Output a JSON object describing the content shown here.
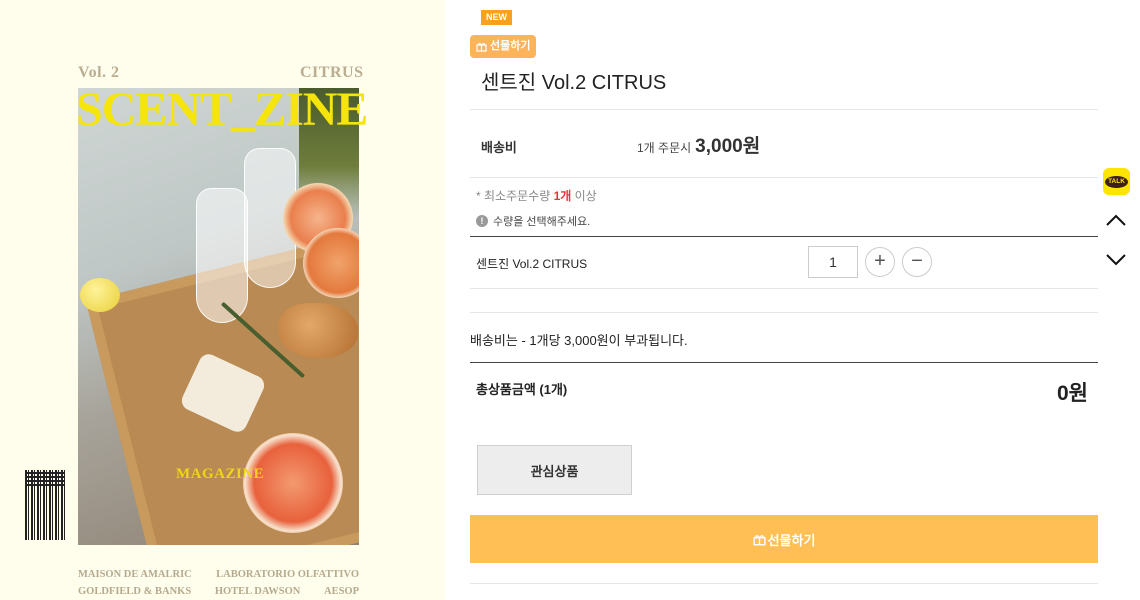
{
  "cover": {
    "vol": "Vol. 2",
    "edition": "CITRUS",
    "title": "SCENT_ZINE",
    "subtitle": "MAGAZINE",
    "credits_row1": [
      "MAISON DE AMALRIC",
      "LABORATORIO OLFATTIVO"
    ],
    "credits_row2": [
      "GOLDFIELD & BANKS",
      "HOTEL DAWSON",
      "AESOP"
    ]
  },
  "badges": {
    "new": "NEW",
    "gift": "선물하기"
  },
  "product": {
    "title": "센트진 Vol.2 CITRUS"
  },
  "shipping": {
    "label": "배송비",
    "prefix": "1개 주문시",
    "amount": "3,000원",
    "note": "배송비는 - 1개당 3,000원이 부과됩니다."
  },
  "order": {
    "min_prefix": "* 최소주문수량 ",
    "min_qty": "1개",
    "min_suffix": " 이상",
    "select_notice": "수량을 선택해주세요."
  },
  "option": {
    "name": "센트진 Vol.2 CITRUS",
    "quantity": "1",
    "plus": "+",
    "minus": "−"
  },
  "total": {
    "label": "총상품금액 (1개)",
    "value": "0원"
  },
  "buttons": {
    "wishlist": "관심상품",
    "gift": "선물하기"
  },
  "floating": {
    "talk": "TALK"
  },
  "colors": {
    "accent": "#ffbf55",
    "new_badge": "#f6a21b",
    "talk": "#fee500"
  }
}
